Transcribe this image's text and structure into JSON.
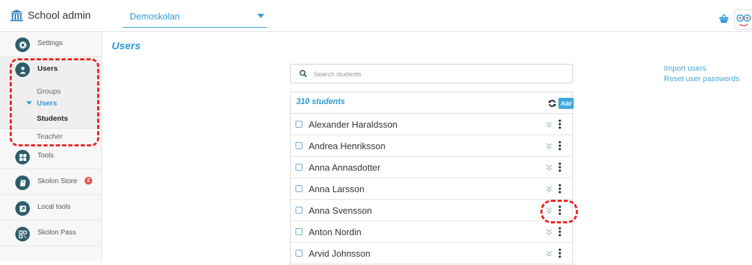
{
  "header": {
    "brand_title": "School admin",
    "school_select": {
      "value": "Demoskolan"
    }
  },
  "sidebar": {
    "items": [
      {
        "label": "Settings",
        "icon": "gear-icon"
      },
      {
        "label": "Users",
        "icon": "user-icon"
      },
      {
        "label": "Tools",
        "icon": "grid-icon"
      },
      {
        "label": "Skolon Store",
        "icon": "book-icon",
        "badge": "2"
      },
      {
        "label": "Local tools",
        "icon": "arrow-icon"
      },
      {
        "label": "Skolon Pass",
        "icon": "qr-icon"
      }
    ],
    "users_sub": {
      "groups": "Groups",
      "users": "Users",
      "students": "Students",
      "teacher": "Teacher"
    }
  },
  "main": {
    "title": "Users",
    "search_placeholder": "Search students",
    "links": {
      "import": "Import users",
      "reset": "Reset user passwords"
    },
    "list": {
      "count_label": "310 students",
      "add_label": "Add",
      "students": [
        "Alexander Haraldsson",
        "Andrea Henriksson",
        "Anna Annasdotter",
        "Anna Larsson",
        "Anna Svensson",
        "Anton Nordin",
        "Arvid Johnsson"
      ]
    }
  },
  "colors": {
    "accent": "#2e9bd8",
    "sidebar_icon": "#2f5c6b",
    "highlight": "#ee2222"
  }
}
